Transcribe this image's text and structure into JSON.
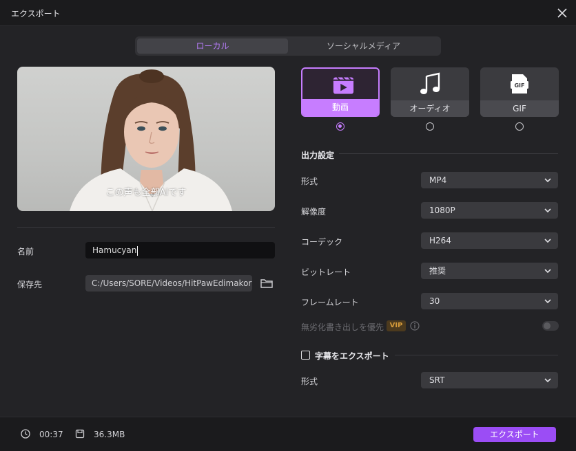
{
  "window": {
    "title": "エクスポート"
  },
  "tabs": [
    {
      "label": "ローカル",
      "active": true
    },
    {
      "label": "ソーシャルメディア",
      "active": false
    }
  ],
  "preview": {
    "caption": "この声も全部AIです"
  },
  "file": {
    "name_label": "名前",
    "name_value": "Hamucyan",
    "path_label": "保存先",
    "path_value": "C:/Users/SORE/Videos/HitPawEdimakor"
  },
  "formats": [
    {
      "label": "動画",
      "icon": "clapperboard-icon",
      "selected": true
    },
    {
      "label": "オーディオ",
      "icon": "music-note-icon",
      "selected": false
    },
    {
      "label": "GIF",
      "icon": "gif-file-icon",
      "selected": false
    }
  ],
  "output_settings": {
    "title": "出力設定",
    "rows": [
      {
        "label": "形式",
        "value": "MP4"
      },
      {
        "label": "解像度",
        "value": "1080P"
      },
      {
        "label": "コーデック",
        "value": "H264"
      },
      {
        "label": "ビットレート",
        "value": "推奨"
      },
      {
        "label": "フレームレート",
        "value": "30"
      }
    ],
    "lossless_label": "無劣化書き出しを優先",
    "vip_badge": "VIP",
    "lossless_enabled": false
  },
  "subtitles": {
    "checkbox_label": "字幕をエクスポート",
    "checked": false,
    "format_label": "形式",
    "format_value": "SRT"
  },
  "footer": {
    "duration": "00:37",
    "size": "36.3MB",
    "export_label": "エクスポート"
  },
  "colors": {
    "accent": "#c77dff",
    "export_button": "#9b4df5",
    "background": "#232326"
  }
}
